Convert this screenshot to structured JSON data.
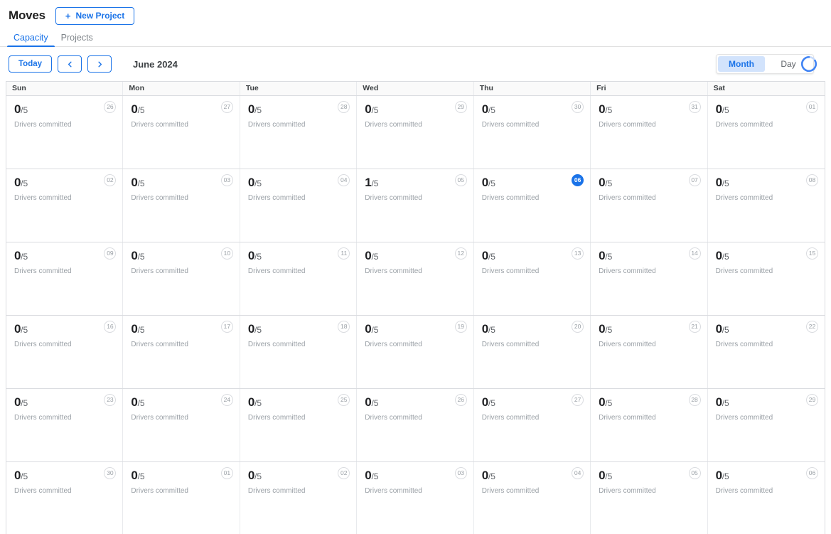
{
  "header": {
    "app_title": "Moves",
    "new_project_label": "New Project",
    "plus_icon": "plus-icon"
  },
  "tabs": [
    {
      "label": "Capacity",
      "active": true
    },
    {
      "label": "Projects",
      "active": false
    }
  ],
  "toolbar": {
    "today_label": "Today",
    "prev_icon": "chevron-left-icon",
    "next_icon": "chevron-right-icon",
    "month_label": "June 2024",
    "views": [
      {
        "label": "Month",
        "selected": true
      },
      {
        "label": "Day",
        "selected": false
      }
    ],
    "loading_icon": "loading-spinner-icon"
  },
  "calendar": {
    "day_of_week_headers": [
      "Sun",
      "Mon",
      "Tue",
      "Wed",
      "Thu",
      "Fri",
      "Sat"
    ],
    "capacity_sublabel": "Drivers committed",
    "capacity_total": "/5",
    "accent_color": "#1a73e8",
    "weeks": [
      [
        {
          "date": "26",
          "count": "0",
          "total": "/5",
          "sub": "Drivers committed",
          "today": false
        },
        {
          "date": "27",
          "count": "0",
          "total": "/5",
          "sub": "Drivers committed",
          "today": false
        },
        {
          "date": "28",
          "count": "0",
          "total": "/5",
          "sub": "Drivers committed",
          "today": false
        },
        {
          "date": "29",
          "count": "0",
          "total": "/5",
          "sub": "Drivers committed",
          "today": false
        },
        {
          "date": "30",
          "count": "0",
          "total": "/5",
          "sub": "Drivers committed",
          "today": false
        },
        {
          "date": "31",
          "count": "0",
          "total": "/5",
          "sub": "Drivers committed",
          "today": false
        },
        {
          "date": "01",
          "count": "0",
          "total": "/5",
          "sub": "Drivers committed",
          "today": false
        }
      ],
      [
        {
          "date": "02",
          "count": "0",
          "total": "/5",
          "sub": "Drivers committed",
          "today": false
        },
        {
          "date": "03",
          "count": "0",
          "total": "/5",
          "sub": "Drivers committed",
          "today": false
        },
        {
          "date": "04",
          "count": "0",
          "total": "/5",
          "sub": "Drivers committed",
          "today": false
        },
        {
          "date": "05",
          "count": "1",
          "total": "/5",
          "sub": "Drivers committed",
          "today": false
        },
        {
          "date": "06",
          "count": "0",
          "total": "/5",
          "sub": "Drivers committed",
          "today": true
        },
        {
          "date": "07",
          "count": "0",
          "total": "/5",
          "sub": "Drivers committed",
          "today": false
        },
        {
          "date": "08",
          "count": "0",
          "total": "/5",
          "sub": "Drivers committed",
          "today": false
        }
      ],
      [
        {
          "date": "09",
          "count": "0",
          "total": "/5",
          "sub": "Drivers committed",
          "today": false
        },
        {
          "date": "10",
          "count": "0",
          "total": "/5",
          "sub": "Drivers committed",
          "today": false
        },
        {
          "date": "11",
          "count": "0",
          "total": "/5",
          "sub": "Drivers committed",
          "today": false
        },
        {
          "date": "12",
          "count": "0",
          "total": "/5",
          "sub": "Drivers committed",
          "today": false
        },
        {
          "date": "13",
          "count": "0",
          "total": "/5",
          "sub": "Drivers committed",
          "today": false
        },
        {
          "date": "14",
          "count": "0",
          "total": "/5",
          "sub": "Drivers committed",
          "today": false
        },
        {
          "date": "15",
          "count": "0",
          "total": "/5",
          "sub": "Drivers committed",
          "today": false
        }
      ],
      [
        {
          "date": "16",
          "count": "0",
          "total": "/5",
          "sub": "Drivers committed",
          "today": false
        },
        {
          "date": "17",
          "count": "0",
          "total": "/5",
          "sub": "Drivers committed",
          "today": false
        },
        {
          "date": "18",
          "count": "0",
          "total": "/5",
          "sub": "Drivers committed",
          "today": false
        },
        {
          "date": "19",
          "count": "0",
          "total": "/5",
          "sub": "Drivers committed",
          "today": false
        },
        {
          "date": "20",
          "count": "0",
          "total": "/5",
          "sub": "Drivers committed",
          "today": false
        },
        {
          "date": "21",
          "count": "0",
          "total": "/5",
          "sub": "Drivers committed",
          "today": false
        },
        {
          "date": "22",
          "count": "0",
          "total": "/5",
          "sub": "Drivers committed",
          "today": false
        }
      ],
      [
        {
          "date": "23",
          "count": "0",
          "total": "/5",
          "sub": "Drivers committed",
          "today": false
        },
        {
          "date": "24",
          "count": "0",
          "total": "/5",
          "sub": "Drivers committed",
          "today": false
        },
        {
          "date": "25",
          "count": "0",
          "total": "/5",
          "sub": "Drivers committed",
          "today": false
        },
        {
          "date": "26",
          "count": "0",
          "total": "/5",
          "sub": "Drivers committed",
          "today": false
        },
        {
          "date": "27",
          "count": "0",
          "total": "/5",
          "sub": "Drivers committed",
          "today": false
        },
        {
          "date": "28",
          "count": "0",
          "total": "/5",
          "sub": "Drivers committed",
          "today": false
        },
        {
          "date": "29",
          "count": "0",
          "total": "/5",
          "sub": "Drivers committed",
          "today": false
        }
      ],
      [
        {
          "date": "30",
          "count": "0",
          "total": "/5",
          "sub": "Drivers committed",
          "today": false
        },
        {
          "date": "01",
          "count": "0",
          "total": "/5",
          "sub": "Drivers committed",
          "today": false
        },
        {
          "date": "02",
          "count": "0",
          "total": "/5",
          "sub": "Drivers committed",
          "today": false
        },
        {
          "date": "03",
          "count": "0",
          "total": "/5",
          "sub": "Drivers committed",
          "today": false
        },
        {
          "date": "04",
          "count": "0",
          "total": "/5",
          "sub": "Drivers committed",
          "today": false
        },
        {
          "date": "05",
          "count": "0",
          "total": "/5",
          "sub": "Drivers committed",
          "today": false
        },
        {
          "date": "06",
          "count": "0",
          "total": "/5",
          "sub": "Drivers committed",
          "today": false
        }
      ]
    ]
  }
}
